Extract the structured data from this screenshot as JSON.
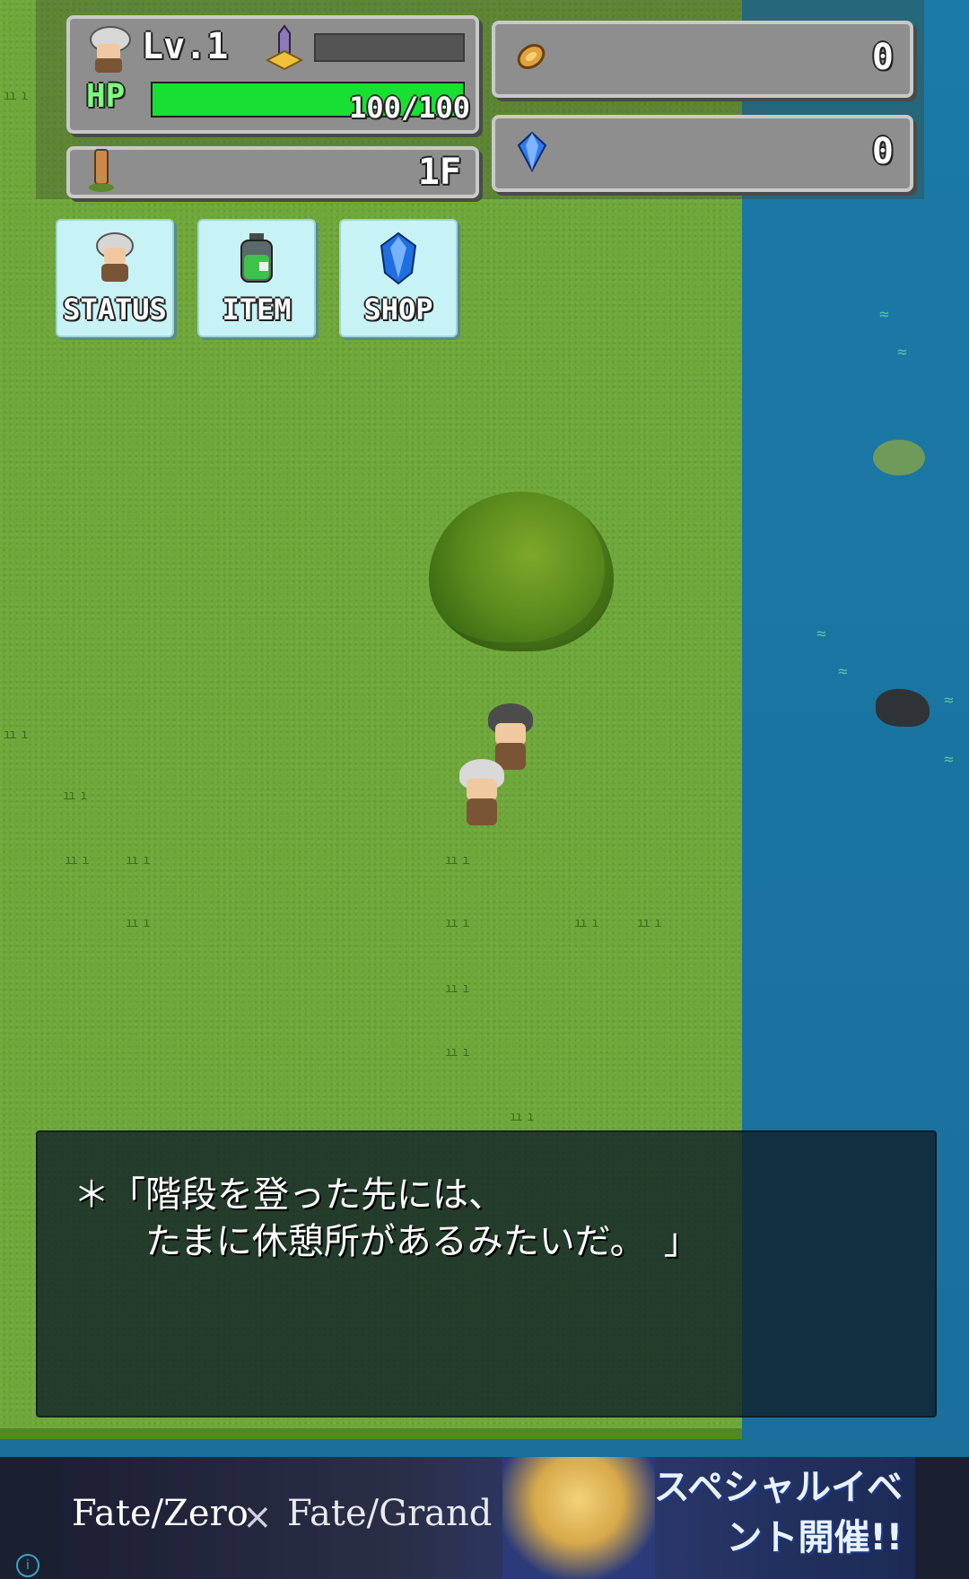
{
  "hud": {
    "level": "Lv.1",
    "exp_fraction": 0.0,
    "hp_label": "HP",
    "hp": "100/100",
    "hp_fraction": 1.0,
    "floor": "1F",
    "coins": "0",
    "gems": "0"
  },
  "menu": {
    "status_label": "STATUS",
    "item_label": "ITEM",
    "shop_label": "SHOP"
  },
  "dialog": {
    "text": "＊「階段を登った先には、\n　　たまに休憩所があるみたいだ。　」"
  },
  "ad": {
    "left_text": "Fate/Zero",
    "x_mark": "×",
    "mid_text": "Fate/Grand Order",
    "right_text": "スペシャルイベント開催!!",
    "info_icon": "i"
  },
  "colors": {
    "grass": "#6fa83a",
    "water": "#1b7aa8",
    "hp_green": "#17e033",
    "button_bg": "#c8f3f6"
  },
  "icons": {
    "hero": "hero-avatar-icon",
    "exp": "sword-icon",
    "floor": "tower-icon",
    "coin": "coin-icon",
    "gem": "gem-icon",
    "item": "potion-icon",
    "shop": "crystal-icon"
  }
}
